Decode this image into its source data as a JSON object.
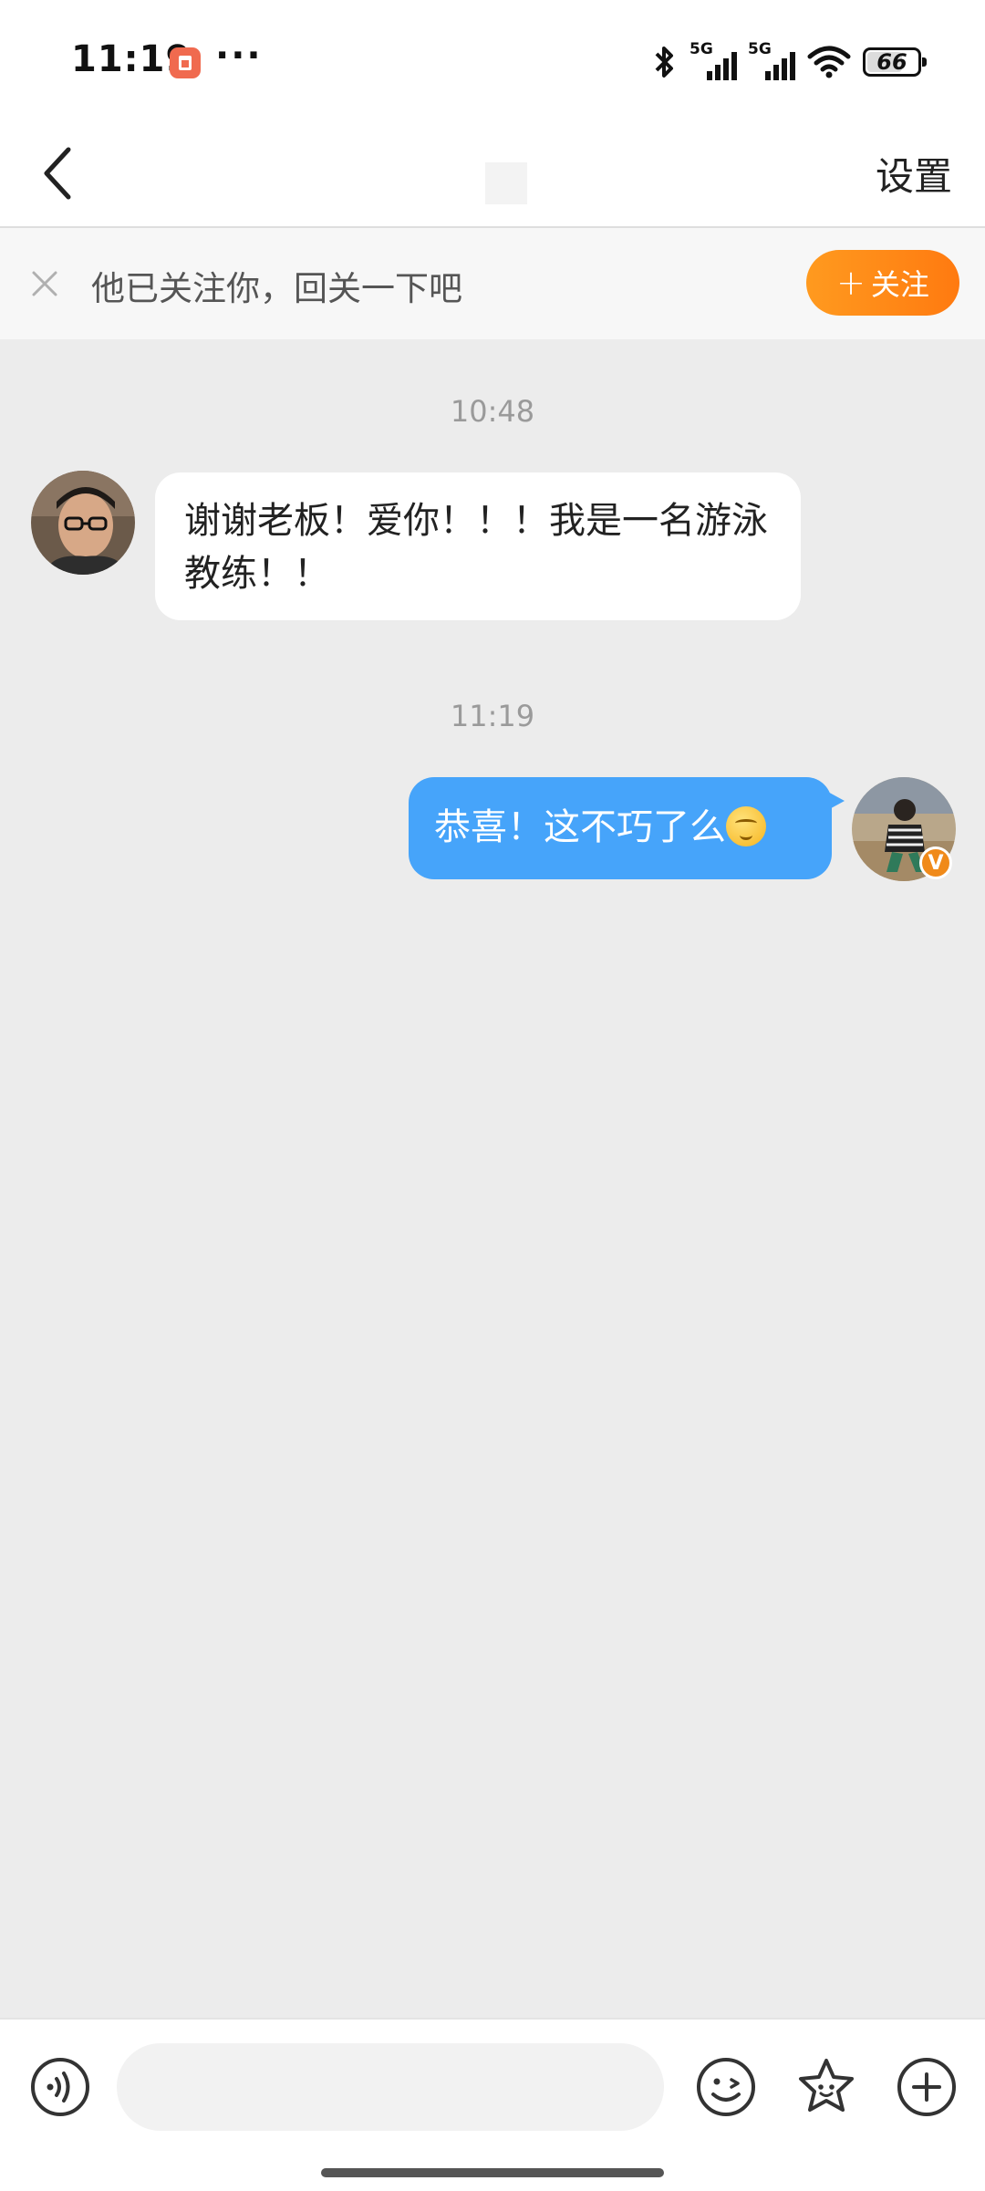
{
  "status_bar": {
    "time": "11:19",
    "more": "···",
    "signal1_label": "5G",
    "signal2_label": "5G",
    "battery": "66"
  },
  "header": {
    "settings_label": "设置"
  },
  "follow_banner": {
    "text": "他已关注你，回关一下吧",
    "button_label": "关注",
    "button_plus": "+"
  },
  "messages": [
    {
      "timestamp": "10:48",
      "direction": "incoming",
      "text": "谢谢老板！爱你！！！我是一名游泳教练！！"
    },
    {
      "timestamp": "11:19",
      "direction": "outgoing",
      "text": "恭喜！这不巧了么",
      "emoji": "thinking-face"
    }
  ],
  "badge": {
    "label": "V"
  },
  "colors": {
    "accent_blue": "#46a4fa",
    "follow_orange": "#ff8a16",
    "chat_background": "#ececec"
  },
  "bottom_bar": {
    "input_value": "",
    "icons": [
      "voice-icon",
      "emoji-icon",
      "sticker-icon",
      "add-icon"
    ]
  }
}
